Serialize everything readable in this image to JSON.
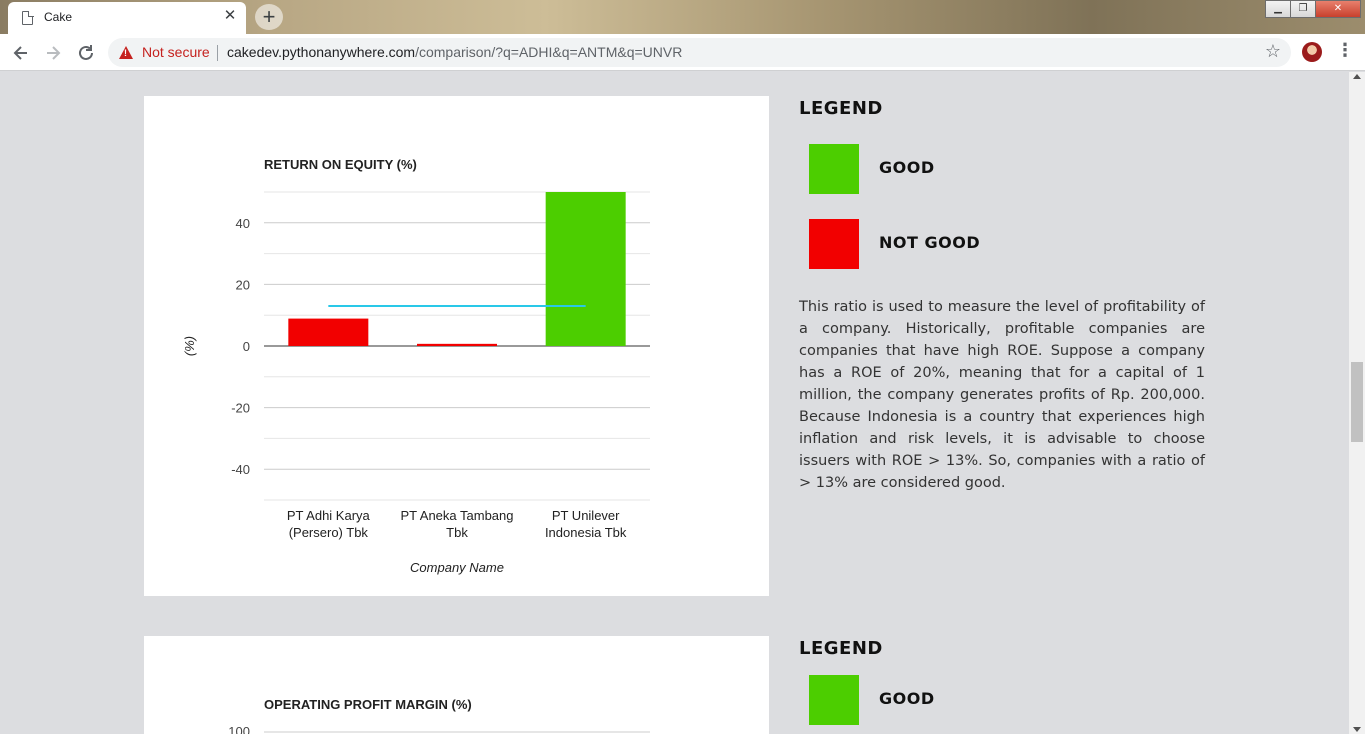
{
  "browser": {
    "tab_title": "Cake",
    "tab_close": "✕",
    "new_tab": "+",
    "security_label": "Not secure",
    "url_host": "cakedev.pythonanywhere.com",
    "url_path": "/comparison/?q=ADHI&q=ANTM&q=UNVR",
    "window_controls": [
      "▁",
      "❐",
      "✕"
    ]
  },
  "legend": {
    "title": "LEGEND",
    "good_label": "GOOD",
    "not_good_label": "NOT GOOD",
    "good_color": "#4cce00",
    "not_good_color": "#f20000",
    "roe_description": "This ratio is used to measure the level of profitability of a company. Historically, profitable companies are companies that have high ROE. Suppose a company has a ROE of 20%, meaning that for a capital of 1 million, the company generates profits of Rp. 200,000. Because Indonesia is a country that experiences high inflation and risk levels, it is advisable to choose issuers with ROE > 13%. So, companies with a ratio of > 13% are considered good."
  },
  "chart_data": [
    {
      "type": "bar",
      "title": "RETURN ON EQUITY (%)",
      "xlabel": "Company Name",
      "ylabel": "(%)",
      "categories": [
        [
          "PT Adhi Karya",
          "(Persero) Tbk"
        ],
        [
          "PT Aneka Tambang",
          "Tbk"
        ],
        [
          "PT Unilever",
          "Indonesia Tbk"
        ]
      ],
      "values": [
        8.9,
        0.7,
        50
      ],
      "bar_colors": [
        "#f20000",
        "#f20000",
        "#4cce00"
      ],
      "threshold": 13,
      "threshold_color": "#29c8e8",
      "yticks": [
        40,
        20,
        0,
        -20,
        -40
      ],
      "ylim": [
        -50,
        50
      ],
      "grid": true
    },
    {
      "type": "bar",
      "title": "OPERATING PROFIT MARGIN (%)",
      "yticks": [
        100
      ],
      "grid": true
    }
  ]
}
